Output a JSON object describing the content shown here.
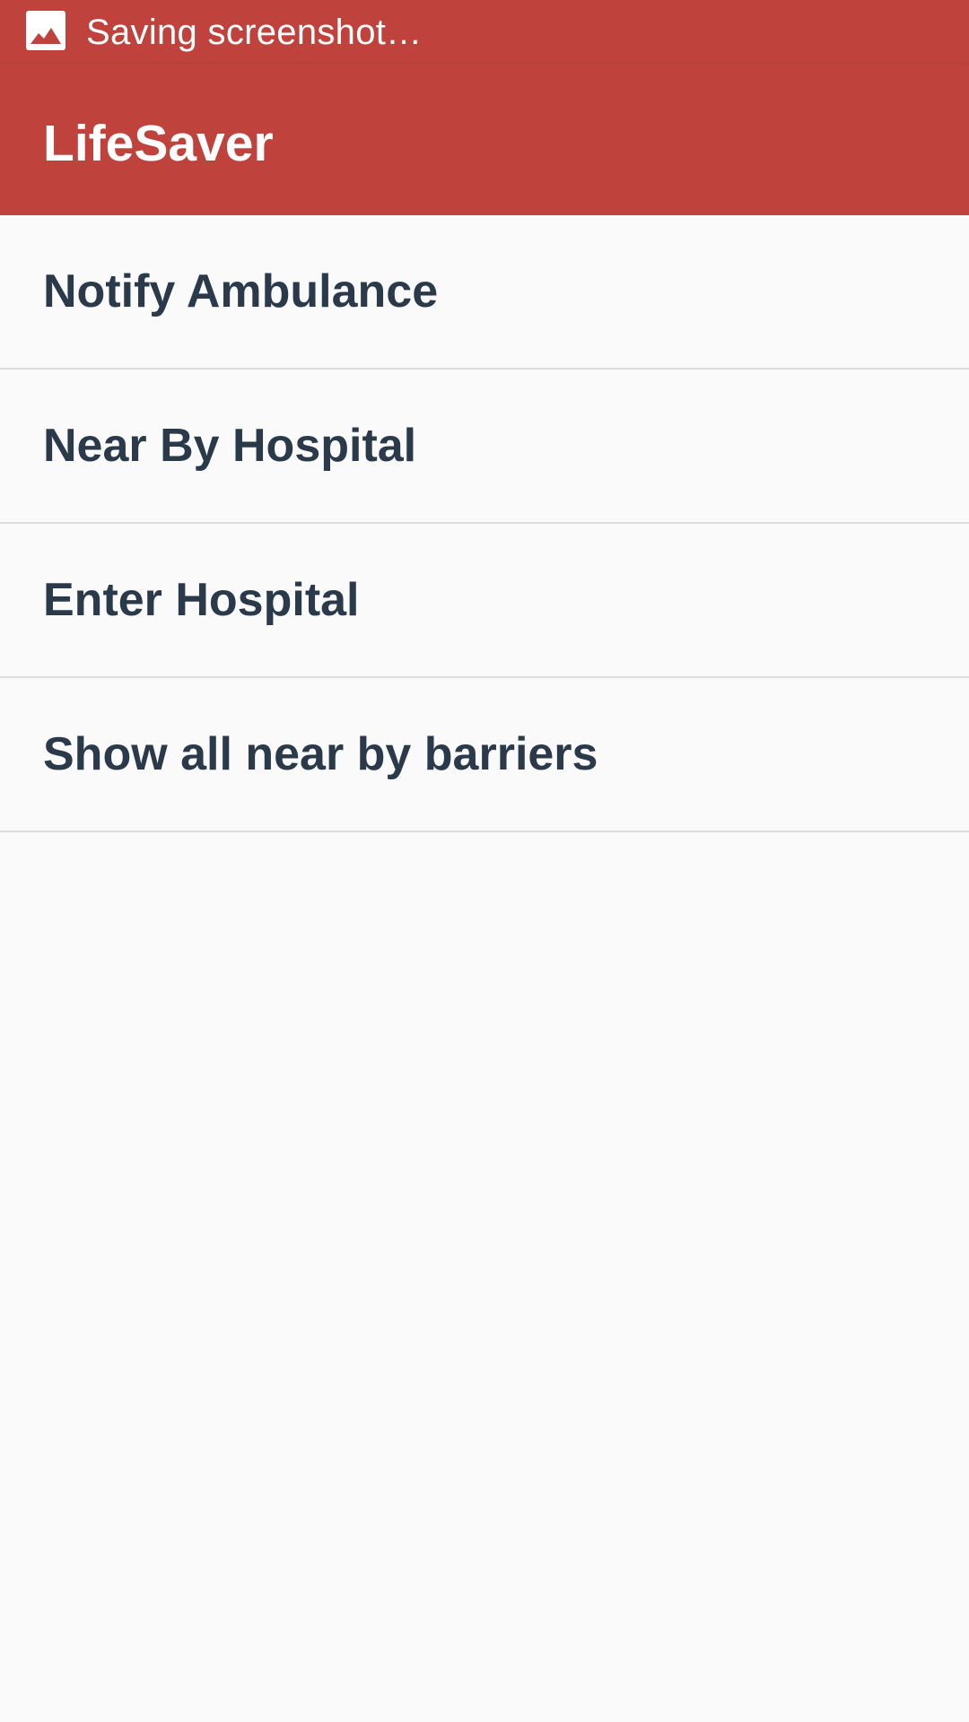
{
  "status_bar": {
    "notification_icon": "image-icon",
    "notification_text": "Saving screenshot…",
    "color": "#bf423d"
  },
  "app_bar": {
    "title": "LifeSaver",
    "color": "#bf423d"
  },
  "menu": {
    "items": [
      {
        "label": "Notify Ambulance"
      },
      {
        "label": "Near By Hospital"
      },
      {
        "label": "Enter Hospital"
      },
      {
        "label": "Show all near by barriers"
      }
    ],
    "text_color": "#2b3a4a"
  }
}
